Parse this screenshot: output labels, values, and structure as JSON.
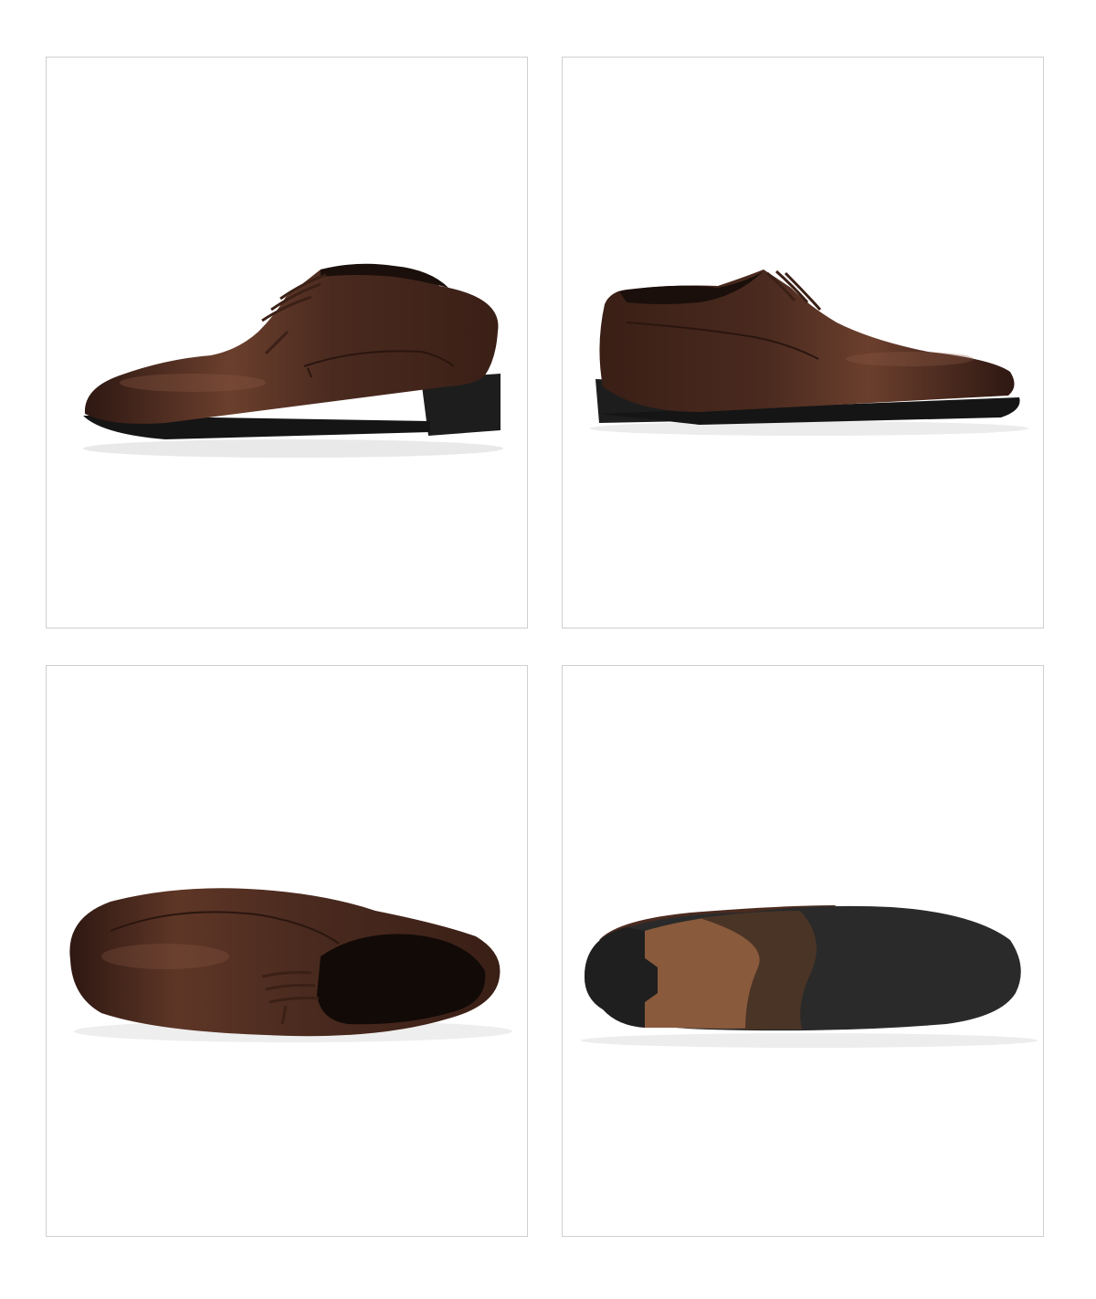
{
  "gallery": {
    "panels": [
      {
        "view": "outer-side-view",
        "shoe_color": "#4a2a1f"
      },
      {
        "view": "inner-side-view",
        "shoe_color": "#4a2a1f"
      },
      {
        "view": "top-view",
        "shoe_color": "#4a2a1f"
      },
      {
        "view": "sole-view",
        "shoe_color": "#4a2a1f",
        "sole_color": "#2a2a2a",
        "heel_color": "#8a5a3c"
      }
    ]
  }
}
